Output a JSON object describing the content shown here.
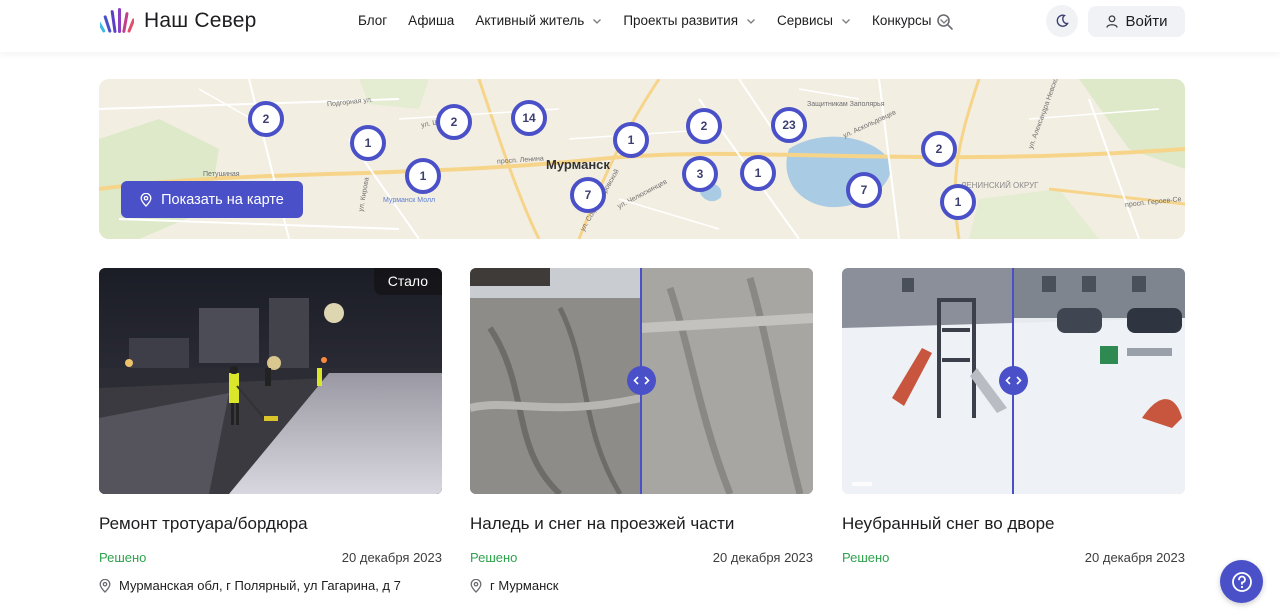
{
  "header": {
    "logo_text": "Наш Север",
    "nav": [
      {
        "label": "Блог",
        "has_dropdown": false
      },
      {
        "label": "Афиша",
        "has_dropdown": false
      },
      {
        "label": "Активный житель",
        "has_dropdown": true
      },
      {
        "label": "Проекты развития",
        "has_dropdown": true
      },
      {
        "label": "Сервисы",
        "has_dropdown": true
      },
      {
        "label": "Конкурсы",
        "has_dropdown": true
      }
    ],
    "login_label": "Войти",
    "icons": {
      "search": "search-icon",
      "theme": "moon-icon",
      "login": "user-icon"
    }
  },
  "map": {
    "city_label": "Мурманск",
    "show_map_label": "Показать на карте",
    "clusters": [
      "2",
      "1",
      "1",
      "2",
      "14",
      "7",
      "1",
      "2",
      "3",
      "1",
      "23",
      "7",
      "2",
      "1"
    ],
    "street_labels": [
      "Подгорная ул.",
      "ул. Шмидта",
      "Петушиная",
      "Мурманск Молл",
      "просп. Ленина",
      "ул. Челюскинцев",
      "ул. Кирова",
      "Защитникам Заполярья",
      "ул. Аскольдовцев",
      "ЛЕНИНСКИЙ ОКРУГ",
      "просп. Героев-Се",
      "ул. Софьи Перовской",
      "ул. Александра Невского"
    ]
  },
  "cards": [
    {
      "title": "Ремонт тротуара/бордюра",
      "status": "Решено",
      "date": "20 декабря 2023",
      "address": "Мурманская обл, г Полярный, ул Гагарина, д 7",
      "badge": "Стало"
    },
    {
      "title": "Наледь и снег на проезжей части",
      "status": "Решено",
      "date": "20 декабря 2023",
      "address": "г Мурманск"
    },
    {
      "title": "Неубранный снег во дворе",
      "status": "Решено",
      "date": "20 декабря 2023",
      "address": ""
    }
  ],
  "colors": {
    "accent": "#4a51c8",
    "status_resolved": "#2ea24d",
    "button_bg": "#f0f2f6"
  }
}
